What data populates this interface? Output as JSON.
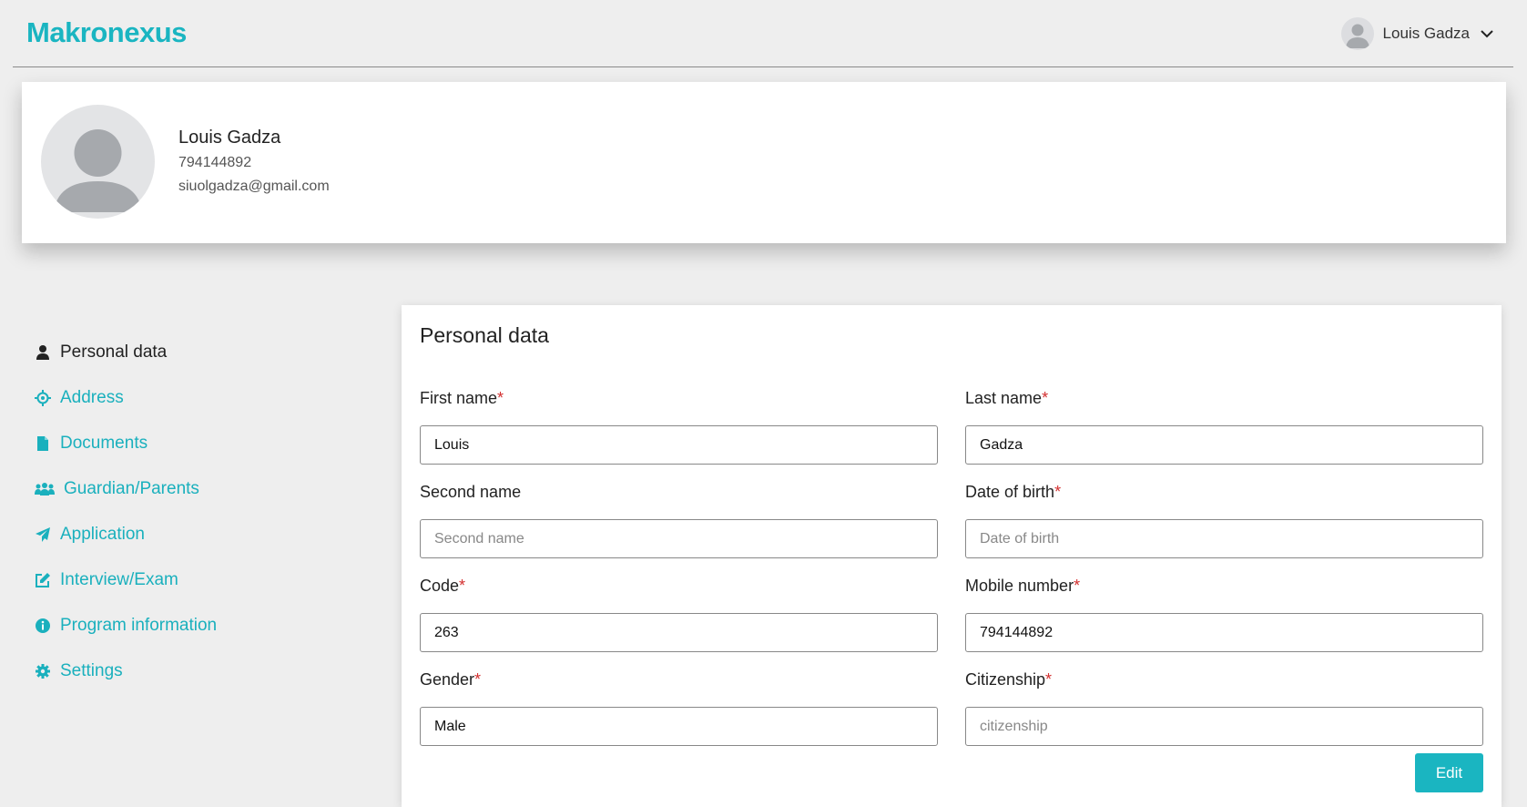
{
  "header": {
    "logo": "Makronexus",
    "user_name": "Louis Gadza"
  },
  "profile": {
    "name": "Louis Gadza",
    "phone": "794144892",
    "email": "siuolgadza@gmail.com"
  },
  "sidebar": {
    "items": [
      {
        "label": "Personal data",
        "icon": "person-icon",
        "active": true
      },
      {
        "label": "Address",
        "icon": "location-target-icon"
      },
      {
        "label": "Documents",
        "icon": "file-icon"
      },
      {
        "label": "Guardian/Parents",
        "icon": "users-icon"
      },
      {
        "label": "Application",
        "icon": "paper-plane-icon"
      },
      {
        "label": "Interview/Exam",
        "icon": "edit-icon"
      },
      {
        "label": "Program information",
        "icon": "info-icon"
      },
      {
        "label": "Settings",
        "icon": "gear-icon"
      }
    ]
  },
  "form": {
    "title": "Personal data",
    "first_name": {
      "label": "First name",
      "value": "Louis"
    },
    "last_name": {
      "label": "Last name",
      "value": "Gadza"
    },
    "second_name": {
      "label": "Second name",
      "placeholder": "Second name",
      "value": ""
    },
    "date_of_birth": {
      "label": "Date of birth",
      "placeholder": "Date of birth",
      "value": ""
    },
    "code": {
      "label": "Code",
      "value": "263"
    },
    "mobile_number": {
      "label": "Mobile number",
      "value": "794144892"
    },
    "gender": {
      "label": "Gender",
      "value": "Male"
    },
    "citizenship": {
      "label": "Citizenship",
      "placeholder": "citizenship",
      "value": ""
    },
    "required_mark": "*",
    "edit_label": "Edit"
  },
  "colors": {
    "accent": "#1ab5c1",
    "required": "#d32f2f",
    "background": "#eeeeee"
  }
}
